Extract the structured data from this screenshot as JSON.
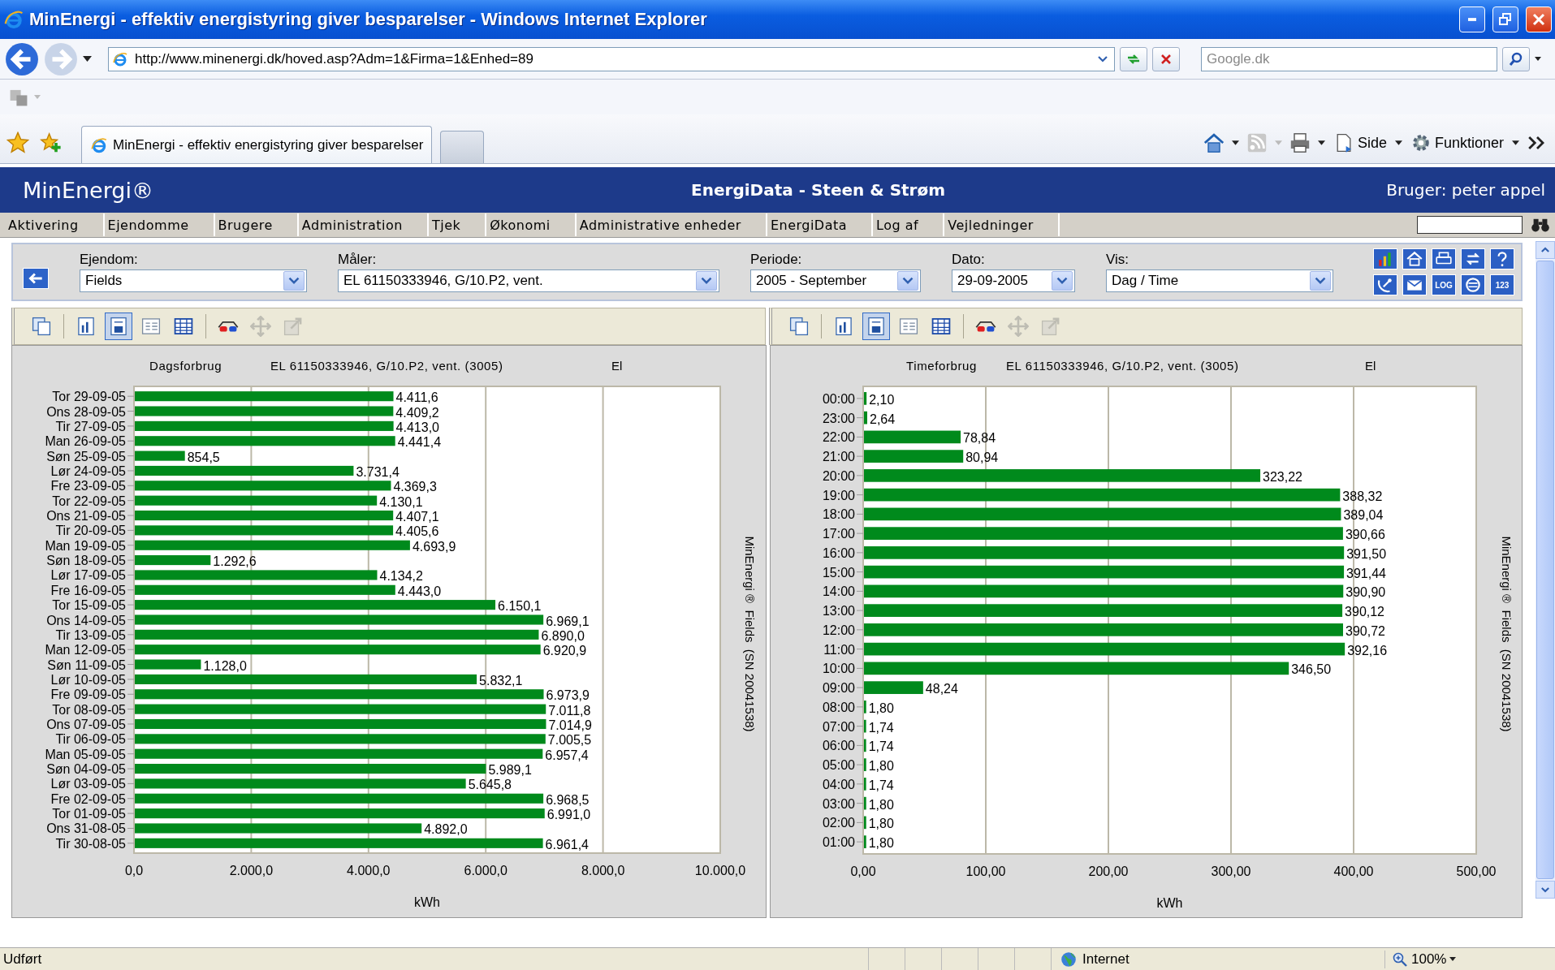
{
  "window": {
    "title": "MinEnergi - effektiv energistyring giver besparelser - Windows Internet Explorer"
  },
  "address_bar": {
    "url": "http://www.minenergi.dk/hoved.asp?Adm=1&Firma=1&Enhed=89",
    "search_placeholder": "Google.dk"
  },
  "browser_tabs": [
    {
      "kind": "page",
      "label": "MinEnergi - effektiv energistyring giver besparelser",
      "selected": true
    },
    {
      "kind": "new",
      "selected": false
    }
  ],
  "command_bar": [
    {
      "kind": "home"
    },
    {
      "kind": "caret"
    },
    {
      "kind": "feed"
    },
    {
      "kind": "caret-grey"
    },
    {
      "kind": "print"
    },
    {
      "kind": "caret"
    },
    {
      "kind": "page",
      "label": "Side"
    },
    {
      "kind": "caret"
    },
    {
      "kind": "gear",
      "label": "Funktioner"
    },
    {
      "kind": "caret"
    },
    {
      "kind": "chevrons"
    }
  ],
  "app_header": {
    "logo": "MinEnergi®",
    "title": "EnergiData - Steen & Strøm",
    "user": "Bruger: peter appel"
  },
  "menu": [
    "Aktivering",
    "Ejendomme",
    "Brugere",
    "Administration",
    "Tjek",
    "Økonomi",
    "Administrative enheder",
    "EnergiData",
    "Log af",
    "Vejledninger"
  ],
  "filters": [
    {
      "label": "Ejendom:",
      "value": "Fields"
    },
    {
      "label": "Måler:",
      "value": "EL 61150333946, G/10.P2, vent."
    },
    {
      "label": "Periode:",
      "value": "2005 - September"
    },
    {
      "label": "Dato:",
      "value": "29-09-2005"
    },
    {
      "label": "Vis:",
      "value": "Dag / Time"
    }
  ],
  "tool_buttons": [
    {
      "kind": "chart"
    },
    {
      "kind": "house"
    },
    {
      "kind": "printer"
    },
    {
      "kind": "swap"
    },
    {
      "kind": "help"
    },
    {
      "kind": "satellite"
    },
    {
      "kind": "mail"
    },
    {
      "kind": "text",
      "label": "LOG"
    },
    {
      "kind": "circle"
    },
    {
      "kind": "text",
      "label": "123"
    }
  ],
  "charts": [
    {
      "toolbar": [
        {
          "kind": "copy",
          "selected": false,
          "disabled": false
        },
        {
          "kind": "bar-doc",
          "selected": false,
          "disabled": false
        },
        {
          "kind": "chart-doc",
          "selected": true,
          "disabled": false
        },
        {
          "kind": "list",
          "selected": false,
          "disabled": false
        },
        {
          "kind": "table",
          "selected": false,
          "disabled": false
        },
        {
          "kind": "glasses",
          "selected": false,
          "disabled": false
        },
        {
          "kind": "move",
          "selected": false,
          "disabled": true
        },
        {
          "kind": "export",
          "selected": false,
          "disabled": true
        }
      ],
      "meter": "EL 61150333946, G/10.P2, vent. (3005)",
      "medium": "El",
      "side_label": "MinEnergi ®  Fields  (SN 20041538)",
      "chart_data": {
        "type": "bar",
        "orientation": "horizontal",
        "grid": true,
        "title": "Dagsforbrug",
        "xlabel": "kWh",
        "categories": [
          "Tor 29-09-05",
          "Ons 28-09-05",
          "Tir 27-09-05",
          "Man 26-09-05",
          "Søn 25-09-05",
          "Lør 24-09-05",
          "Fre 23-09-05",
          "Tor 22-09-05",
          "Ons 21-09-05",
          "Tir 20-09-05",
          "Man 19-09-05",
          "Søn 18-09-05",
          "Lør 17-09-05",
          "Fre 16-09-05",
          "Tor 15-09-05",
          "Ons 14-09-05",
          "Tir 13-09-05",
          "Man 12-09-05",
          "Søn 11-09-05",
          "Lør 10-09-05",
          "Fre 09-09-05",
          "Tor 08-09-05",
          "Ons 07-09-05",
          "Tir 06-09-05",
          "Man 05-09-05",
          "Søn 04-09-05",
          "Lør 03-09-05",
          "Fre 02-09-05",
          "Tor 01-09-05",
          "Ons 31-08-05",
          "Tir 30-08-05"
        ],
        "series": [
          {
            "color": "#008a1c",
            "values": [
              4411.6,
              4409.2,
              4413.0,
              4441.4,
              854.5,
              3731.4,
              4369.3,
              4130.1,
              4407.1,
              4405.6,
              4693.9,
              1292.6,
              4134.2,
              4443.0,
              6150.1,
              6969.1,
              6890.0,
              6920.9,
              1128.0,
              5832.1,
              6973.9,
              7011.8,
              7014.9,
              7005.5,
              6957.4,
              5989.1,
              5645.8,
              6968.5,
              6991.0,
              4892.0,
              6961.4
            ]
          }
        ],
        "value_labels": [
          "4.411,6",
          "4.409,2",
          "4.413,0",
          "4.441,4",
          "854,5",
          "3.731,4",
          "4.369,3",
          "4.130,1",
          "4.407,1",
          "4.405,6",
          "4.693,9",
          "1.292,6",
          "4.134,2",
          "4.443,0",
          "6.150,1",
          "6.969,1",
          "6.890,0",
          "6.920,9",
          "1.128,0",
          "5.832,1",
          "6.973,9",
          "7.011,8",
          "7.014,9",
          "7.005,5",
          "6.957,4",
          "5.989,1",
          "5.645,8",
          "6.968,5",
          "6.991,0",
          "4.892,0",
          "6.961,4"
        ],
        "xlim": [
          0,
          10000
        ],
        "xticks": [
          {
            "value": 0,
            "label": "0,0"
          },
          {
            "value": 2000,
            "label": "2.000,0"
          },
          {
            "value": 4000,
            "label": "4.000,0"
          },
          {
            "value": 6000,
            "label": "6.000,0"
          },
          {
            "value": 8000,
            "label": "8.000,0"
          },
          {
            "value": 10000,
            "label": "10.000,0"
          }
        ]
      }
    },
    {
      "toolbar": [
        {
          "kind": "copy",
          "selected": false,
          "disabled": false
        },
        {
          "kind": "bar-doc",
          "selected": false,
          "disabled": false
        },
        {
          "kind": "chart-doc",
          "selected": true,
          "disabled": false
        },
        {
          "kind": "list",
          "selected": false,
          "disabled": false
        },
        {
          "kind": "table",
          "selected": false,
          "disabled": false
        },
        {
          "kind": "glasses",
          "selected": false,
          "disabled": false
        },
        {
          "kind": "move",
          "selected": false,
          "disabled": true
        },
        {
          "kind": "export",
          "selected": false,
          "disabled": true
        }
      ],
      "meter": "EL 61150333946, G/10.P2, vent. (3005)",
      "medium": "El",
      "side_label": "MinEnergi ®  Fields  (SN 20041538)",
      "chart_data": {
        "type": "bar",
        "orientation": "horizontal",
        "grid": true,
        "title": "Timeforbrug",
        "xlabel": "kWh",
        "categories": [
          "00:00",
          "23:00",
          "22:00",
          "21:00",
          "20:00",
          "19:00",
          "18:00",
          "17:00",
          "16:00",
          "15:00",
          "14:00",
          "13:00",
          "12:00",
          "11:00",
          "10:00",
          "09:00",
          "08:00",
          "07:00",
          "06:00",
          "05:00",
          "04:00",
          "03:00",
          "02:00",
          "01:00"
        ],
        "series": [
          {
            "color": "#008a1c",
            "values": [
              2.1,
              2.64,
              78.84,
              80.94,
              323.22,
              388.32,
              389.04,
              390.66,
              391.5,
              391.44,
              390.9,
              390.12,
              390.72,
              392.16,
              346.5,
              48.24,
              1.8,
              1.74,
              1.74,
              1.8,
              1.74,
              1.8,
              1.8,
              1.8
            ]
          }
        ],
        "value_labels": [
          "2,10",
          "2,64",
          "78,84",
          "80,94",
          "323,22",
          "388,32",
          "389,04",
          "390,66",
          "391,50",
          "391,44",
          "390,90",
          "390,12",
          "390,72",
          "392,16",
          "346,50",
          "48,24",
          "1,80",
          "1,74",
          "1,74",
          "1,80",
          "1,74",
          "1,80",
          "1,80",
          "1,80"
        ],
        "xlim": [
          0,
          500
        ],
        "xticks": [
          {
            "value": 0,
            "label": "0,00"
          },
          {
            "value": 100,
            "label": "100,00"
          },
          {
            "value": 200,
            "label": "200,00"
          },
          {
            "value": 300,
            "label": "300,00"
          },
          {
            "value": 400,
            "label": "400,00"
          },
          {
            "value": 500,
            "label": "500,00"
          }
        ]
      }
    }
  ],
  "status_bar": {
    "status": "Udført",
    "zone": "Internet",
    "zoom": "100%"
  }
}
